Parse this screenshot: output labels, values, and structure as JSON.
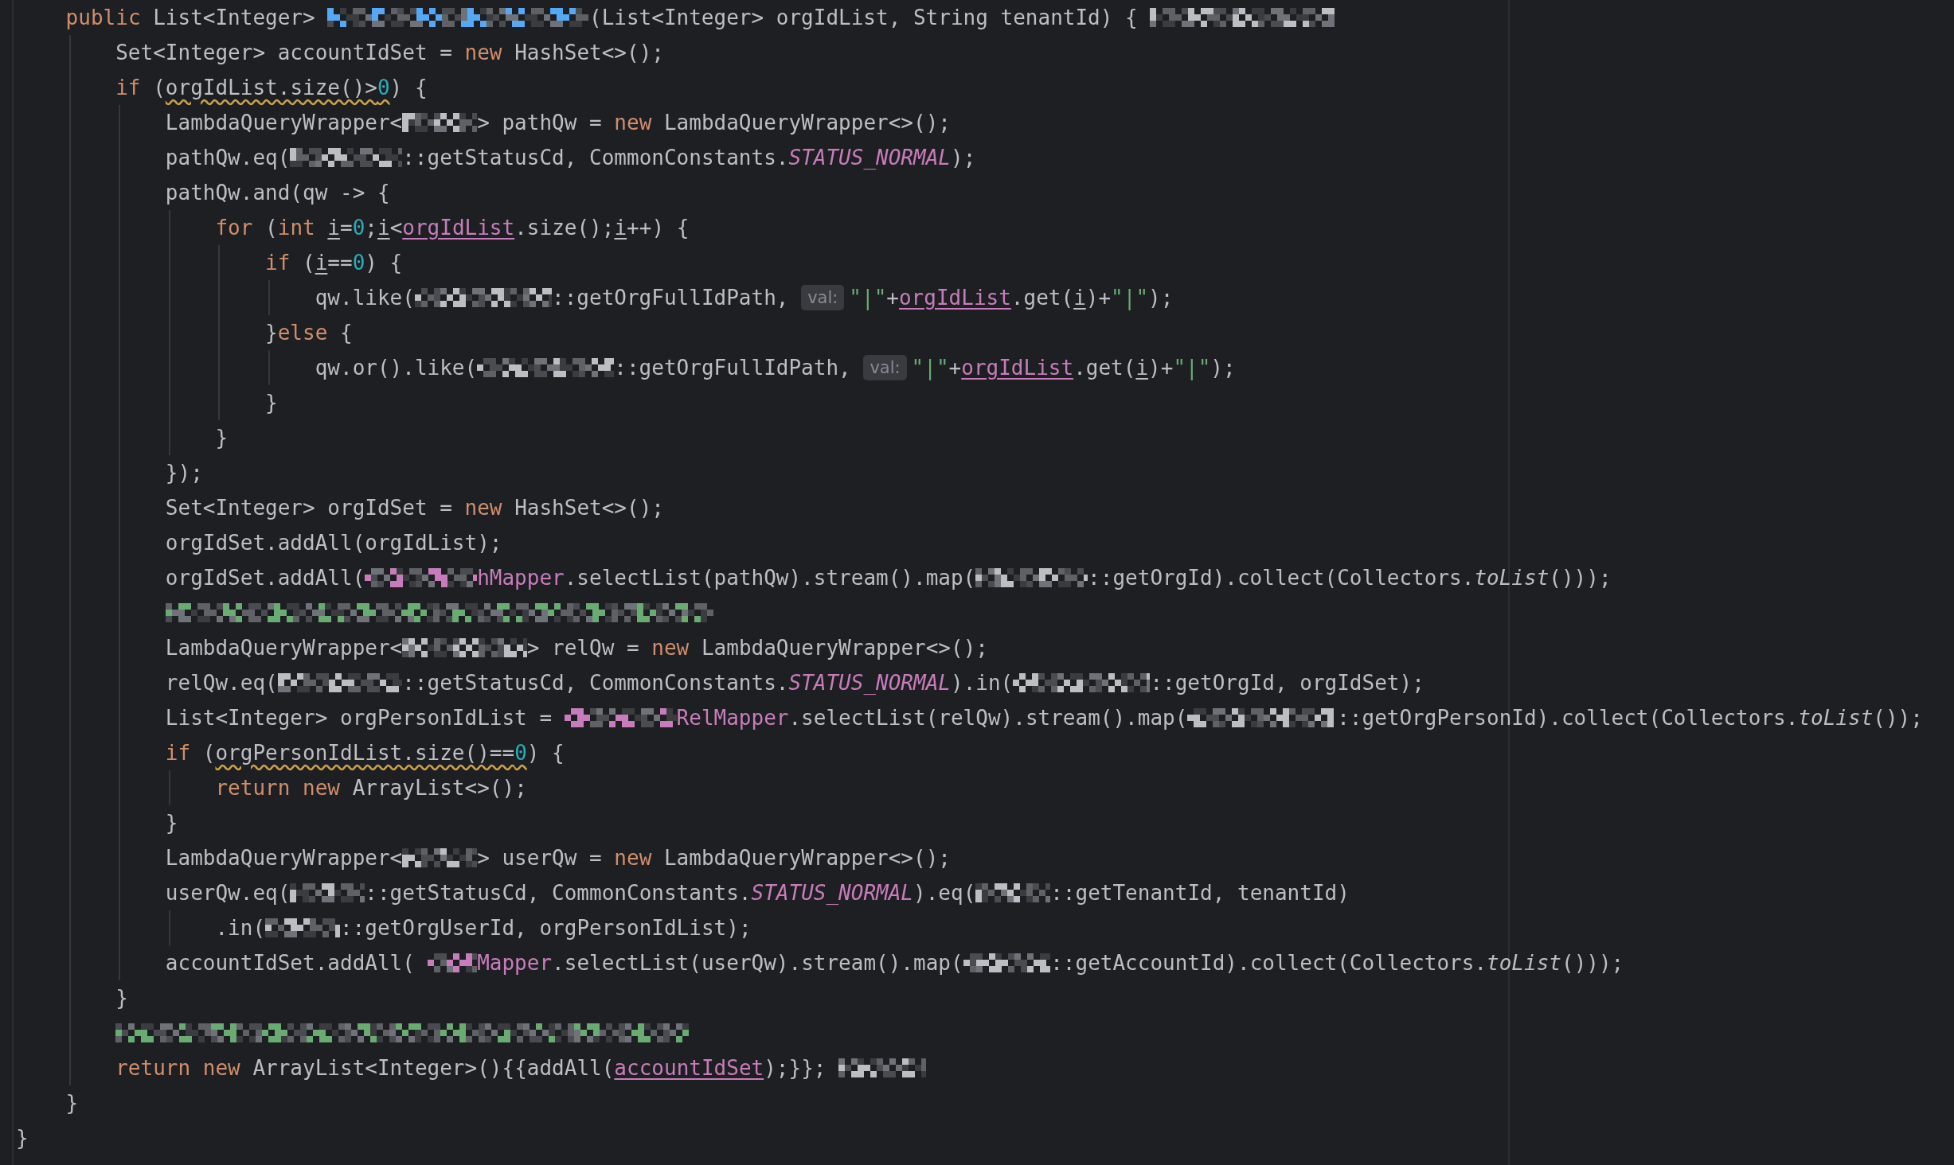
{
  "editor": {
    "lines": [
      {
        "children": [
          {
            "tokens": [
              {
                "text": "public ",
                "kind": "kw"
              },
              {
                "text": "List<Integer> ",
                "kind": "plain"
              },
              {
                "kind": "redacted",
                "color": "#56a8f5"
              },
              {
                "text": "(List<Integer> orgIdList, String tenantId) { ",
                "kind": "plain"
              },
              {
                "kind": "redacted",
                "color": "#bcbec4"
              }
            ],
            "children": [
              {
                "tokens": [
                  {
                    "text": "Set<Integer> accountIdSet = ",
                    "kind": "plain"
                  },
                  {
                    "text": "new ",
                    "kind": "kw"
                  },
                  {
                    "text": "HashSet<>();",
                    "kind": "plain"
                  }
                ]
              },
              {
                "tokens": [
                  {
                    "text": "if ",
                    "kind": "kw"
                  },
                  {
                    "text": "(",
                    "kind": "plain"
                  },
                  {
                    "text": "orgIdList.size()>",
                    "kind": "warn"
                  },
                  {
                    "text": "0",
                    "kind": "warnnum"
                  },
                  {
                    "text": ") {",
                    "kind": "plain"
                  }
                ],
                "children": [
                  {
                    "tokens": [
                      {
                        "text": "LambdaQueryWrapper<",
                        "kind": "plain"
                      },
                      {
                        "kind": "redacted",
                        "color": "#bcbec4"
                      },
                      {
                        "text": "> pathQw = ",
                        "kind": "plain"
                      },
                      {
                        "text": "new ",
                        "kind": "kw"
                      },
                      {
                        "text": "LambdaQueryWrapper<>();",
                        "kind": "plain"
                      }
                    ]
                  },
                  {
                    "tokens": [
                      {
                        "text": "pathQw.eq(",
                        "kind": "plain"
                      },
                      {
                        "kind": "redacted",
                        "color": "#bcbec4"
                      },
                      {
                        "text": "::getStatusCd, CommonConstants.",
                        "kind": "plain"
                      },
                      {
                        "text": "STATUS_NORMAL",
                        "kind": "field"
                      },
                      {
                        "text": ");",
                        "kind": "plain"
                      }
                    ]
                  },
                  {
                    "tokens": [
                      {
                        "text": "pathQw.and(qw -> {",
                        "kind": "plain"
                      }
                    ],
                    "children": [
                      {
                        "tokens": [
                          {
                            "text": "for ",
                            "kind": "kw"
                          },
                          {
                            "text": "(",
                            "kind": "plain"
                          },
                          {
                            "text": "int ",
                            "kind": "kw"
                          },
                          {
                            "text": "i",
                            "kind": "reassign"
                          },
                          {
                            "text": "=",
                            "kind": "plain"
                          },
                          {
                            "text": "0",
                            "kind": "num"
                          },
                          {
                            "text": ";",
                            "kind": "plain"
                          },
                          {
                            "text": "i",
                            "kind": "reassign"
                          },
                          {
                            "text": "<",
                            "kind": "plain"
                          },
                          {
                            "text": "orgIdList",
                            "kind": "captured"
                          },
                          {
                            "text": ".size();",
                            "kind": "plain"
                          },
                          {
                            "text": "i",
                            "kind": "reassign"
                          },
                          {
                            "text": "++) {",
                            "kind": "plain"
                          }
                        ],
                        "children": [
                          {
                            "tokens": [
                              {
                                "text": "if ",
                                "kind": "kw"
                              },
                              {
                                "text": "(",
                                "kind": "plain"
                              },
                              {
                                "text": "i",
                                "kind": "reassign"
                              },
                              {
                                "text": "==",
                                "kind": "plain"
                              },
                              {
                                "text": "0",
                                "kind": "num"
                              },
                              {
                                "text": ") {",
                                "kind": "plain"
                              }
                            ],
                            "children": [
                              {
                                "tokens": [
                                  {
                                    "text": "qw.like(",
                                    "kind": "plain"
                                  },
                                  {
                                    "kind": "redacted",
                                    "color": "#bcbec4"
                                  },
                                  {
                                    "text": "::getOrgFullIdPath, ",
                                    "kind": "plain"
                                  },
                                  {
                                    "text": "val:",
                                    "kind": "hint"
                                  },
                                  {
                                    "text": "\"|\"",
                                    "kind": "str"
                                  },
                                  {
                                    "text": "+",
                                    "kind": "plain"
                                  },
                                  {
                                    "text": "orgIdList",
                                    "kind": "captured"
                                  },
                                  {
                                    "text": ".get(",
                                    "kind": "plain"
                                  },
                                  {
                                    "text": "i",
                                    "kind": "reassign"
                                  },
                                  {
                                    "text": ")+",
                                    "kind": "plain"
                                  },
                                  {
                                    "text": "\"|\"",
                                    "kind": "str"
                                  },
                                  {
                                    "text": ");",
                                    "kind": "plain"
                                  }
                                ]
                              }
                            ]
                          },
                          {
                            "tokens": [
                              {
                                "text": "}",
                                "kind": "plain"
                              },
                              {
                                "text": "else ",
                                "kind": "kw"
                              },
                              {
                                "text": "{",
                                "kind": "plain"
                              }
                            ],
                            "children": [
                              {
                                "tokens": [
                                  {
                                    "text": "qw.or().like(",
                                    "kind": "plain"
                                  },
                                  {
                                    "kind": "redacted",
                                    "color": "#bcbec4"
                                  },
                                  {
                                    "text": "::getOrgFullIdPath, ",
                                    "kind": "plain"
                                  },
                                  {
                                    "text": "val:",
                                    "kind": "hint"
                                  },
                                  {
                                    "text": "\"|\"",
                                    "kind": "str"
                                  },
                                  {
                                    "text": "+",
                                    "kind": "plain"
                                  },
                                  {
                                    "text": "orgIdList",
                                    "kind": "captured"
                                  },
                                  {
                                    "text": ".get(",
                                    "kind": "plain"
                                  },
                                  {
                                    "text": "i",
                                    "kind": "reassign"
                                  },
                                  {
                                    "text": ")+",
                                    "kind": "plain"
                                  },
                                  {
                                    "text": "\"|\"",
                                    "kind": "str"
                                  },
                                  {
                                    "text": ");",
                                    "kind": "plain"
                                  }
                                ]
                              }
                            ]
                          },
                          {
                            "tokens": [
                              {
                                "text": "}",
                                "kind": "plain"
                              }
                            ]
                          }
                        ]
                      },
                      {
                        "tokens": [
                          {
                            "text": "}",
                            "kind": "plain"
                          }
                        ]
                      }
                    ]
                  },
                  {
                    "tokens": [
                      {
                        "text": "});",
                        "kind": "plain"
                      }
                    ]
                  },
                  {
                    "tokens": [
                      {
                        "text": "Set<Integer> orgIdSet = ",
                        "kind": "plain"
                      },
                      {
                        "text": "new ",
                        "kind": "kw"
                      },
                      {
                        "text": "HashSet<>();",
                        "kind": "plain"
                      }
                    ]
                  },
                  {
                    "tokens": [
                      {
                        "text": "orgIdSet.addAll(orgIdList);",
                        "kind": "plain"
                      }
                    ]
                  },
                  {
                    "tokens": [
                      {
                        "text": "orgIdSet.addAll(",
                        "kind": "plain"
                      },
                      {
                        "kind": "redacted",
                        "color": "#c77dbb"
                      },
                      {
                        "text": "hMapper",
                        "kind": "member"
                      },
                      {
                        "text": ".selectList(pathQw).stream().map(",
                        "kind": "plain"
                      },
                      {
                        "kind": "redacted",
                        "color": "#bcbec4"
                      },
                      {
                        "text": "::getOrgId).collect(Collectors.",
                        "kind": "plain"
                      },
                      {
                        "text": "toList",
                        "kind": "static"
                      },
                      {
                        "text": "()));",
                        "kind": "plain"
                      }
                    ]
                  },
                  {
                    "tokens": [
                      {
                        "kind": "redacted",
                        "color": "#6aab73"
                      }
                    ]
                  },
                  {
                    "tokens": [
                      {
                        "text": "LambdaQueryWrapper<",
                        "kind": "plain"
                      },
                      {
                        "kind": "redacted",
                        "color": "#bcbec4"
                      },
                      {
                        "text": "> relQw = ",
                        "kind": "plain"
                      },
                      {
                        "text": "new ",
                        "kind": "kw"
                      },
                      {
                        "text": "LambdaQueryWrapper<>();",
                        "kind": "plain"
                      }
                    ]
                  },
                  {
                    "tokens": [
                      {
                        "text": "relQw.eq(",
                        "kind": "plain"
                      },
                      {
                        "kind": "redacted",
                        "color": "#bcbec4"
                      },
                      {
                        "text": "::getStatusCd, CommonConstants.",
                        "kind": "plain"
                      },
                      {
                        "text": "STATUS_NORMAL",
                        "kind": "field"
                      },
                      {
                        "text": ").in(",
                        "kind": "plain"
                      },
                      {
                        "kind": "redacted",
                        "color": "#bcbec4"
                      },
                      {
                        "text": "::getOrgId, orgIdSet);",
                        "kind": "plain"
                      }
                    ]
                  },
                  {
                    "tokens": [
                      {
                        "text": "List<Integer> orgPersonIdList = ",
                        "kind": "plain"
                      },
                      {
                        "kind": "redacted",
                        "color": "#c77dbb"
                      },
                      {
                        "text": "RelMapper",
                        "kind": "member"
                      },
                      {
                        "text": ".selectList(relQw).stream().map(",
                        "kind": "plain"
                      },
                      {
                        "kind": "redacted",
                        "color": "#bcbec4"
                      },
                      {
                        "text": "::getOrgPersonId).collect(Collectors.",
                        "kind": "plain"
                      },
                      {
                        "text": "toList",
                        "kind": "static"
                      },
                      {
                        "text": "());",
                        "kind": "plain"
                      }
                    ]
                  },
                  {
                    "tokens": [
                      {
                        "text": "if ",
                        "kind": "kw"
                      },
                      {
                        "text": "(",
                        "kind": "plain"
                      },
                      {
                        "text": "orgPersonIdList.size()==",
                        "kind": "warn"
                      },
                      {
                        "text": "0",
                        "kind": "warnnum"
                      },
                      {
                        "text": ") {",
                        "kind": "plain"
                      }
                    ],
                    "children": [
                      {
                        "tokens": [
                          {
                            "text": "return new ",
                            "kind": "kw"
                          },
                          {
                            "text": "ArrayList<>();",
                            "kind": "plain"
                          }
                        ]
                      }
                    ]
                  },
                  {
                    "tokens": [
                      {
                        "text": "}",
                        "kind": "plain"
                      }
                    ]
                  },
                  {
                    "tokens": [
                      {
                        "text": "LambdaQueryWrapper<",
                        "kind": "plain"
                      },
                      {
                        "kind": "redacted",
                        "color": "#bcbec4"
                      },
                      {
                        "text": "> userQw = ",
                        "kind": "plain"
                      },
                      {
                        "text": "new ",
                        "kind": "kw"
                      },
                      {
                        "text": "LambdaQueryWrapper<>();",
                        "kind": "plain"
                      }
                    ]
                  },
                  {
                    "tokens": [
                      {
                        "text": "userQw.eq(",
                        "kind": "plain"
                      },
                      {
                        "kind": "redacted",
                        "color": "#bcbec4"
                      },
                      {
                        "text": "::getStatusCd, CommonConstants.",
                        "kind": "plain"
                      },
                      {
                        "text": "STATUS_NORMAL",
                        "kind": "field"
                      },
                      {
                        "text": ").eq(",
                        "kind": "plain"
                      },
                      {
                        "kind": "redacted",
                        "color": "#bcbec4"
                      },
                      {
                        "text": "::getTenantId, tenantId)",
                        "kind": "plain"
                      }
                    ],
                    "children": [
                      {
                        "tokens": [
                          {
                            "text": ".in(",
                            "kind": "plain"
                          },
                          {
                            "kind": "redacted",
                            "color": "#bcbec4"
                          },
                          {
                            "text": "::getOrgUserId, orgPersonIdList);",
                            "kind": "plain"
                          }
                        ]
                      }
                    ]
                  },
                  {
                    "tokens": [
                      {
                        "text": "accountIdSet.addAll( ",
                        "kind": "plain"
                      },
                      {
                        "kind": "redacted",
                        "color": "#c77dbb"
                      },
                      {
                        "text": "Mapper",
                        "kind": "member"
                      },
                      {
                        "text": ".selectList(userQw).stream().map(",
                        "kind": "plain"
                      },
                      {
                        "kind": "redacted",
                        "color": "#bcbec4"
                      },
                      {
                        "text": "::getAccountId).collect(Collectors.",
                        "kind": "plain"
                      },
                      {
                        "text": "toList",
                        "kind": "static"
                      },
                      {
                        "text": "()));",
                        "kind": "plain"
                      }
                    ]
                  }
                ]
              },
              {
                "tokens": [
                  {
                    "text": "}",
                    "kind": "plain"
                  }
                ]
              },
              {
                "tokens": [
                  {
                    "kind": "redacted",
                    "color": "#6aab73"
                  }
                ]
              },
              {
                "tokens": [
                  {
                    "text": "return new ",
                    "kind": "kw"
                  },
                  {
                    "text": "ArrayList<Integer>(){{addAll(",
                    "kind": "plain"
                  },
                  {
                    "text": "accountIdSet",
                    "kind": "captured"
                  },
                  {
                    "text": ");}}; ",
                    "kind": "plain"
                  },
                  {
                    "kind": "redacted",
                    "color": "#bcbec4"
                  }
                ]
              }
            ]
          },
          {
            "tokens": [
              {
                "text": "}",
                "kind": "plain"
              }
            ]
          }
        ]
      },
      {
        "tokens": [
          {
            "text": "}",
            "kind": "plain"
          }
        ]
      }
    ]
  }
}
